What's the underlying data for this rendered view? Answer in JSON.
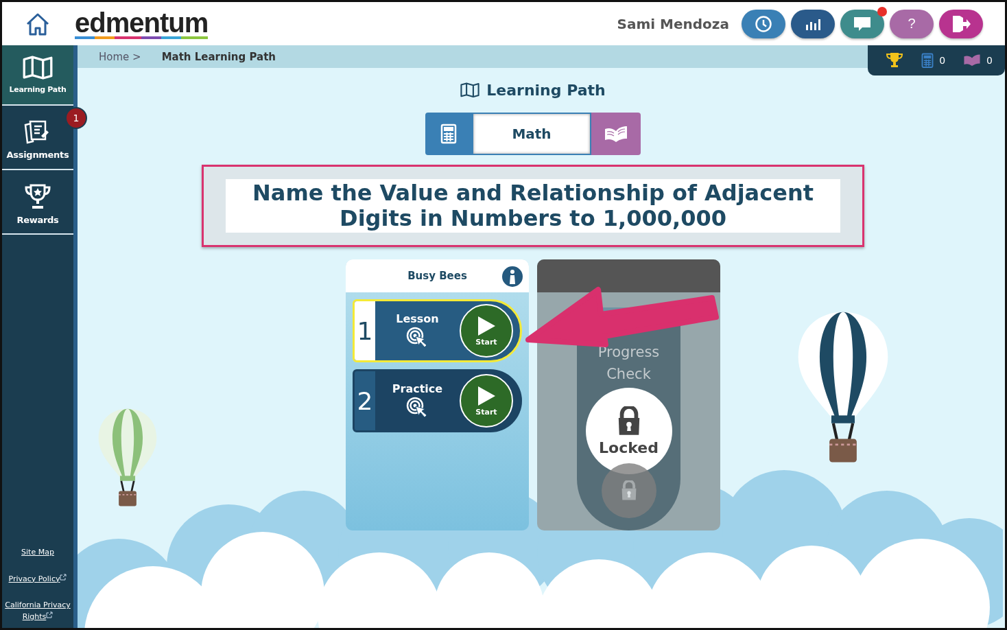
{
  "header": {
    "logo": "edmentum",
    "user_name": "Sami Mendoza",
    "buttons": [
      {
        "kind": "clock",
        "notification": false
      },
      {
        "kind": "chart",
        "notification": false
      },
      {
        "kind": "chat",
        "notification": true
      },
      {
        "kind": "help",
        "label": "?",
        "notification": false
      },
      {
        "kind": "logout",
        "notification": false
      }
    ]
  },
  "sidebar": {
    "items": [
      {
        "label": "Learning Path",
        "kind": "map",
        "selected": true
      },
      {
        "label": "Assignments",
        "kind": "assignments",
        "selected": false,
        "badge": "1"
      },
      {
        "label": "Rewards",
        "kind": "trophy",
        "selected": false
      }
    ],
    "footer_links": [
      {
        "label": "Site Map",
        "external": false
      },
      {
        "label": "Privacy Policy",
        "external": true
      },
      {
        "label": "California Privacy Rights",
        "external": true
      }
    ]
  },
  "breadcrumb": {
    "home": "Home >",
    "current": "Math Learning Path"
  },
  "stats": [
    {
      "kind": "trophy"
    },
    {
      "kind": "calculator",
      "count": "0"
    },
    {
      "kind": "book",
      "count": "0"
    }
  ],
  "page_title": "Learning Path",
  "subject_tabs": [
    {
      "kind": "calculator",
      "selected": false
    },
    {
      "kind": "text",
      "label": "Math",
      "selected": true
    },
    {
      "kind": "book",
      "selected": false
    }
  ],
  "topic_heading": "Name the Value and Relationship of Adjacent Digits in Numbers to 1,000,000",
  "activity_group": {
    "title": "Busy Bees",
    "activities": [
      {
        "number": "1",
        "title": "Lesson",
        "action": "Start",
        "selected": true
      },
      {
        "number": "2",
        "title": "Practice",
        "action": "Start",
        "selected": false
      }
    ]
  },
  "locked_card": {
    "title": "Progress Check",
    "status": "Locked",
    "locked": true
  }
}
